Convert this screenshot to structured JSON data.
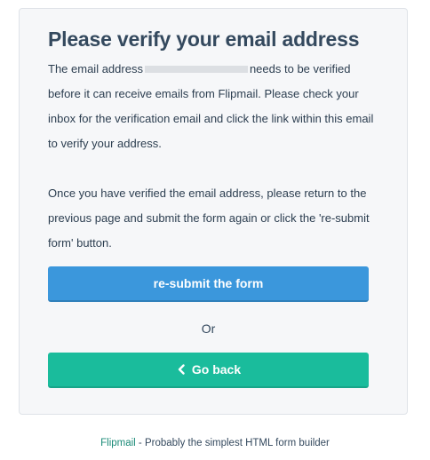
{
  "card": {
    "title": "Please verify your email address",
    "paragraph1_before": "The email address",
    "paragraph1_after": "needs to be verified before it can receive emails from Flipmail. Please check your inbox for the verification email and click the link within this email to verify your address.",
    "paragraph2": "Once you have verified the email address, please return to the previous page and submit the form again or click the 're-submit form' button."
  },
  "actions": {
    "resubmit_label": "re-submit the form",
    "or_label": "Or",
    "back_label": "Go back"
  },
  "footer": {
    "brand": "Flipmail",
    "tagline": " - Probably the simplest HTML form builder"
  },
  "icons": {
    "back": "chevron-left-icon"
  },
  "colors": {
    "primary_button": "#3b97dc",
    "secondary_button": "#1abc9c",
    "footer_link": "#1a8a77"
  }
}
